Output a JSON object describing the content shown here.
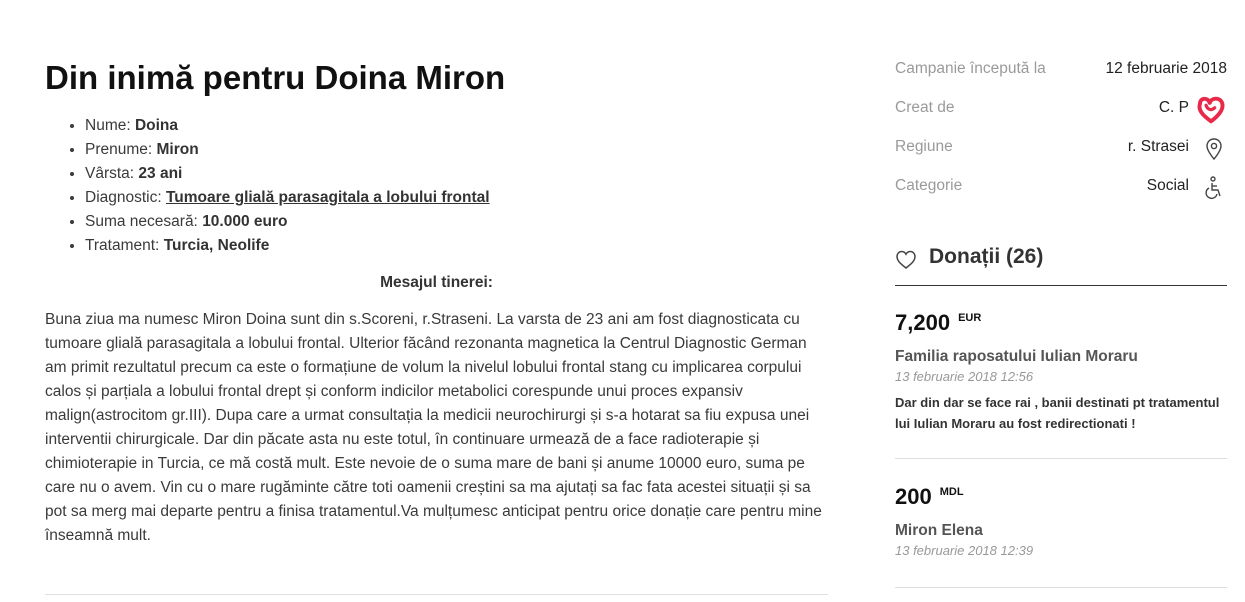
{
  "campaign": {
    "title": "Din inimă pentru Doina Miron",
    "info": [
      {
        "label": "Nume: ",
        "value": "Doina"
      },
      {
        "label": "Prenume: ",
        "value": "Miron"
      },
      {
        "label": "Vârsta: ",
        "value": "23 ani"
      },
      {
        "label": "Diagnostic: ",
        "value": "Tumoare glială parasagitala a lobului frontal"
      },
      {
        "label": "Suma necesară: ",
        "value": "10.000 euro"
      },
      {
        "label": "Tratament: ",
        "value": "Turcia, Neolife"
      }
    ],
    "message_title": "Mesajul tinerei:",
    "message": "Buna ziua ma numesc Miron Doina sunt din s.Scoreni, r.Straseni. La varsta de 23 ani  am fost diagnosticata cu tumoare glială parasagitala a lobului frontal. Ulterior făcând rezonanta magnetica la Centrul Diagnostic German am primit rezultatul precum ca este o formațiune de volum la nivelul lobului frontal stang cu implicarea corpului calos și parțiala a lobului frontal drept și conform indicilor metabolici corespunde unui proces expansiv malign(astrocitom gr.III). Dupa care a urmat consultația la medicii neurochirurgi și s-a hotarat sa fiu expusa unei interventii chirurgicale. Dar din păcate asta nu este totul, în continuare urmează de a face radioterapie și chimioterapie in Turcia, ce mă costă mult. Este nevoie de o suma mare de bani și anume 10000 euro, suma pe care nu o avem. Vin cu o mare rugăminte către toti oamenii creștini sa ma ajutați sa fac fata acestei situații și sa pot sa merg mai departe pentru a finisa tratamentul.Va mulțumesc anticipat pentru orice donație care pentru mine înseamnă mult."
  },
  "sidebar": {
    "meta": [
      {
        "label": "Campanie începută la",
        "value": "12 februarie 2018",
        "icon": ""
      },
      {
        "label": "Creat de",
        "value": "C. P",
        "icon": "heart-logo-icon"
      },
      {
        "label": "Regiune",
        "value": "r. Strasei",
        "icon": "location-pin-icon"
      },
      {
        "label": "Categorie",
        "value": "Social",
        "icon": "wheelchair-icon"
      }
    ],
    "donations_title": "Donații (26)",
    "donations": [
      {
        "amount": "7,200",
        "currency": "EUR",
        "name": "Familia raposatului Iulian Moraru",
        "date": "13 februarie 2018 12:56",
        "note": "Dar din dar se face rai , banii destinati pt tratamentul lui Iulian Moraru au fost redirectionati !"
      },
      {
        "amount": "200",
        "currency": "MDL",
        "name": "Miron Elena",
        "date": "13 februarie 2018 12:39",
        "note": ""
      }
    ]
  },
  "colors": {
    "brand": "#e8294a",
    "label": "#9a9a9a",
    "text": "#3a3a3a"
  }
}
